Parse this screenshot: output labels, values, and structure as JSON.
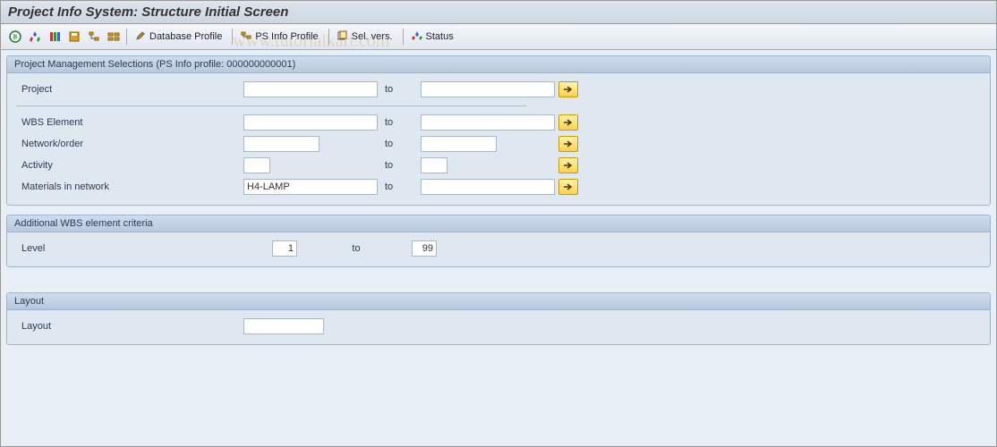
{
  "title": "Project Info System: Structure Initial Screen",
  "toolbar": {
    "database_profile": "Database Profile",
    "ps_info_profile": "PS Info Profile",
    "sel_vers": "Sel. vers.",
    "status": "Status"
  },
  "panels": {
    "pm_selections": {
      "header": "Project Management Selections (PS Info profile: 000000000001)",
      "project_label": "Project",
      "project_from": "",
      "project_to": "",
      "wbs_label": "WBS Element",
      "wbs_from": "",
      "wbs_to": "",
      "network_label": "Network/order",
      "network_from": "",
      "network_to": "",
      "activity_label": "Activity",
      "activity_from": "",
      "activity_to": "",
      "materials_label": "Materials in network",
      "materials_from": "H4-LAMP",
      "materials_to": "",
      "to_label": "to"
    },
    "additional_wbs": {
      "header": "Additional WBS element criteria",
      "level_label": "Level",
      "level_from": "1",
      "level_to": "99",
      "to_label": "to"
    },
    "layout": {
      "header": "Layout",
      "layout_label": "Layout",
      "layout_value": ""
    }
  },
  "watermark": "www.tutorialkart.com"
}
